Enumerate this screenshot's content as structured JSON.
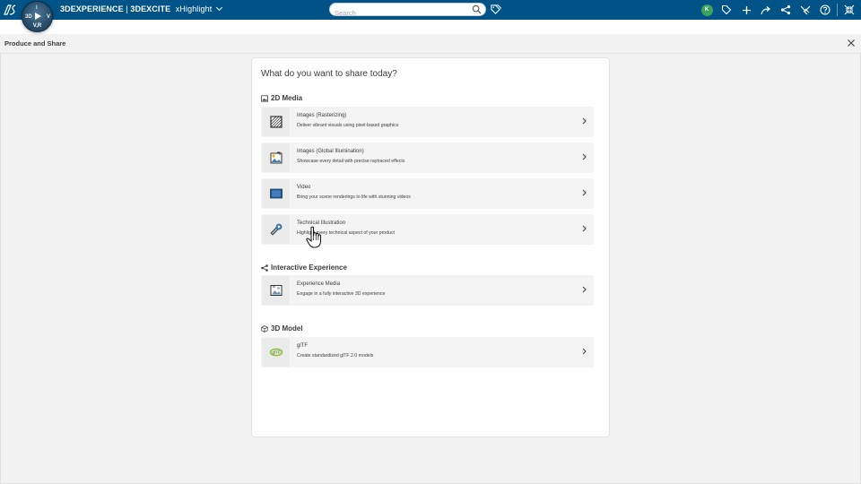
{
  "topbar": {
    "compass_quadrants": [
      "3D",
      "i",
      "V"
    ],
    "compass_version": "V,R",
    "brand_part1": "3DEXPERIENCE",
    "brand_separator": " | ",
    "brand_part2": "3DEXCITE",
    "app_name": "xHighlight",
    "search_placeholder": "Search",
    "user_initials": "K"
  },
  "panel": {
    "title": "Produce and Share"
  },
  "content": {
    "question": "What do you want to share today?",
    "sections": [
      {
        "title": "2D Media",
        "icon": "image-icon",
        "options": [
          {
            "title": "Images (Rasterizing)",
            "desc": "Deliver vibrant visuals using pixel-based graphics",
            "icon": "rasterize-icon"
          },
          {
            "title": "Images (Global Illumination)",
            "desc": "Showcase every detail with precise raytraced effects",
            "icon": "global-illumination-icon"
          },
          {
            "title": "Video",
            "desc": "Bring your scene renderings to life with stunning videos",
            "icon": "video-icon"
          },
          {
            "title": "Technical Illustration",
            "desc": "Highlight every technical aspect of your product",
            "icon": "technical-illustration-icon"
          }
        ]
      },
      {
        "title": "Interactive Experience",
        "icon": "share-nodes-icon",
        "options": [
          {
            "title": "Experience Media",
            "desc": "Engage in a fully interactive 3D experience",
            "icon": "experience-media-icon"
          }
        ]
      },
      {
        "title": "3D Model",
        "icon": "cube-icon",
        "options": [
          {
            "title": "glTF",
            "desc": "Create standardized glTF 2.0 models",
            "icon": "gltf-icon"
          }
        ]
      }
    ]
  },
  "colors": {
    "topbar_bg": "#005386",
    "avatar": "#3ea35a",
    "card_bg": "#ffffff",
    "option_bg": "#f4f4f4",
    "page_bg": "#f2f2f2"
  }
}
